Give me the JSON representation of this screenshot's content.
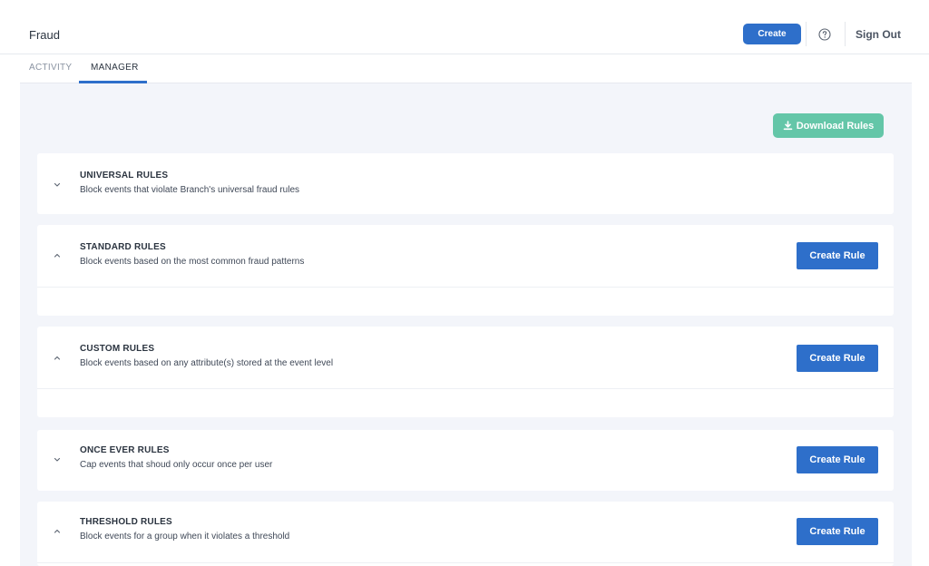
{
  "header": {
    "title": "Fraud",
    "create_label": "Create",
    "help_icon": "question-circle-icon",
    "signout_label": "Sign Out"
  },
  "tabs": [
    {
      "label": "ACTIVITY",
      "active": false
    },
    {
      "label": "MANAGER",
      "active": true
    }
  ],
  "download_label": "Download Rules",
  "rules": [
    {
      "title": "UNIVERSAL RULES",
      "description": "Block events that violate Branch's universal fraud rules",
      "expanded": false
    },
    {
      "title": "STANDARD RULES",
      "description": "Block events based on the most common fraud patterns",
      "button": "Create Rule",
      "expanded": true
    },
    {
      "title": "CUSTOM RULES",
      "description": "Block events based on any attribute(s) stored at the event level",
      "button": "Create Rule",
      "expanded": true
    },
    {
      "title": "ONCE EVER RULES",
      "description": "Cap events that shoud only occur once per user",
      "button": "Create Rule",
      "expanded": false
    },
    {
      "title": "THRESHOLD RULES",
      "description": "Block events for a group when it violates a threshold",
      "button": "Create Rule",
      "expanded": true
    }
  ],
  "colors": {
    "primary": "#2e6fca",
    "download": "#64c6a8",
    "background": "#f3f5fa"
  }
}
